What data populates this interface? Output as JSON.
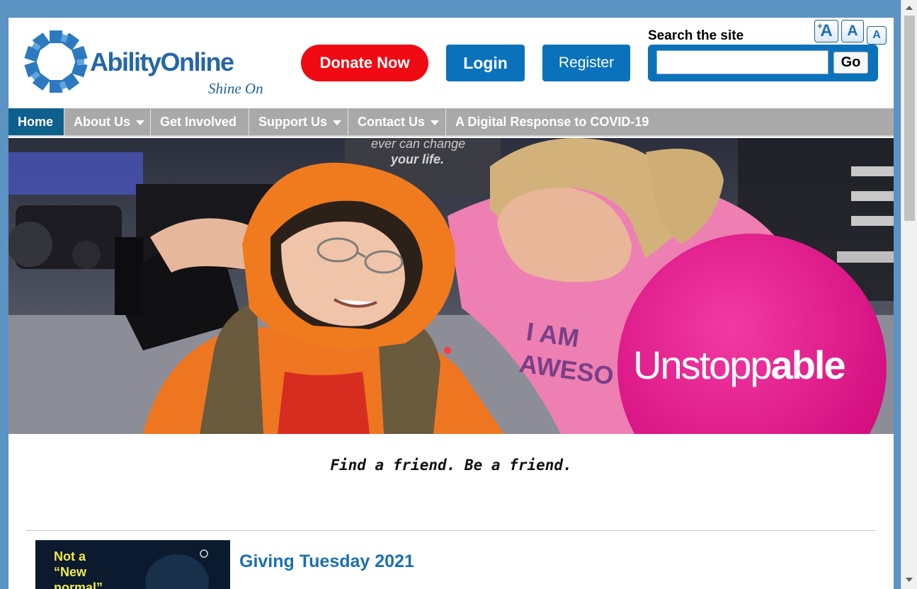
{
  "brand": {
    "name": "AbilityOnline",
    "tagline": "Shine On"
  },
  "header": {
    "donate_label": "Donate Now",
    "login_label": "Login",
    "register_label": "Register",
    "search_label": "Search the site",
    "search_value": "",
    "go_label": "Go",
    "font_size_buttons": [
      "A",
      "A",
      "A"
    ]
  },
  "nav": {
    "items": [
      {
        "label": "Home",
        "active": true,
        "has_menu": false
      },
      {
        "label": "About Us",
        "active": false,
        "has_menu": true
      },
      {
        "label": "Get Involved",
        "active": false,
        "has_menu": false
      },
      {
        "label": "Support Us",
        "active": false,
        "has_menu": true
      },
      {
        "label": "Contact Us",
        "active": false,
        "has_menu": true
      },
      {
        "label": "A Digital Response to COVID-19",
        "active": false,
        "has_menu": false
      }
    ]
  },
  "hero": {
    "badge_text_light": "Unstopp",
    "badge_text_bold": "able",
    "shirt_text": "I AM\nAWESO",
    "sign_text": "ever can change\nyour life."
  },
  "motto": "Find a friend. Be a friend.",
  "article": {
    "thumb_text": "Not a\n“New\nnormal”",
    "title": "Giving Tuesday 2021"
  },
  "colors": {
    "accent_blue": "#0a72bb",
    "donate_red": "#f00a13",
    "nav_gray": "#a9a9a9",
    "nav_active": "#0f5f8c",
    "badge_pink": "#e40f8a",
    "page_frame": "#5b93c2"
  }
}
